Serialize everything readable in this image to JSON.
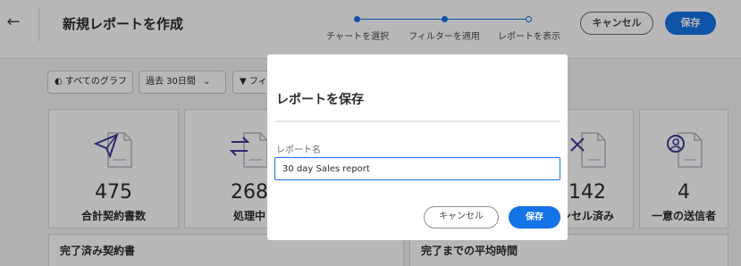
{
  "header": {
    "title": "新規レポートを作成",
    "steps": [
      {
        "label": "チャートを選択",
        "state": "done"
      },
      {
        "label": "フィルターを適用",
        "state": "done"
      },
      {
        "label": "レポートを表示",
        "state": "current"
      }
    ],
    "cancel_label": "キャンセル",
    "save_label": "保存"
  },
  "toolbar": {
    "all_graphs": "すべてのグラフ",
    "date_range": "過去 30日間",
    "filter": "フィ"
  },
  "cards": [
    {
      "value": "475",
      "label": "合計契約書数",
      "icon": "send-document-icon"
    },
    {
      "value": "268",
      "label": "処理中",
      "icon": "exchange-document-icon"
    },
    {
      "value": "142",
      "label": "ンセル済み",
      "icon": "cancelled-document-icon"
    },
    {
      "value": "4",
      "label": "一意の送信者",
      "icon": "user-document-icon"
    }
  ],
  "sections": {
    "completed": "完了済み契約書",
    "avg_time": "完了までの平均時間"
  },
  "modal": {
    "title": "レポートを保存",
    "field_label": "レポート名",
    "field_value": "30 day Sales report",
    "cancel_label": "キャンセル",
    "save_label": "保存"
  },
  "colors": {
    "accent": "#1473e6",
    "icon": "#3d3a9a"
  }
}
